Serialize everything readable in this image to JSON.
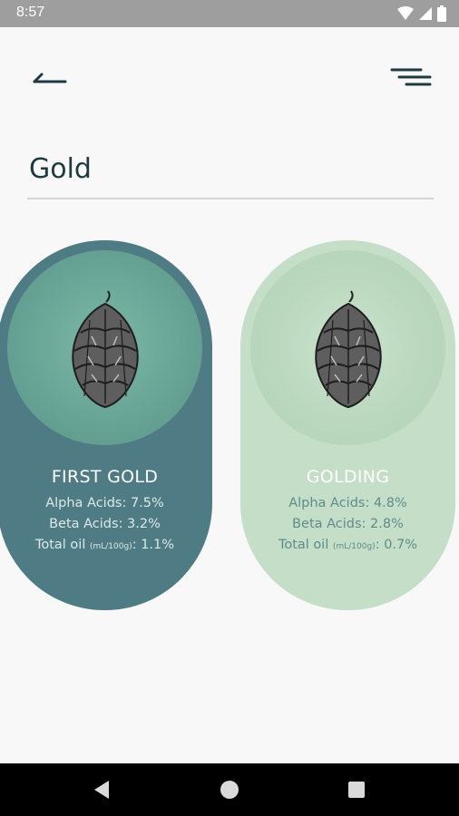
{
  "status_bar": {
    "time": "8:57",
    "icons": [
      "wifi-icon",
      "signal-icon",
      "battery-icon"
    ]
  },
  "header": {
    "back_icon": "back-arrow-icon",
    "menu_icon": "menu-icon"
  },
  "search": {
    "value": "Gold"
  },
  "cards": [
    {
      "name": "FIRST GOLD",
      "alpha": "Alpha Acids: 7.5%",
      "beta": "Beta Acids: 3.2%",
      "oil_label": "Total oil",
      "oil_unit": "(mL/100g)",
      "oil_value": ": 1.1%",
      "colors": {
        "card": "#4f7c84",
        "circle": "#6ba899",
        "text": "#ffffff"
      }
    },
    {
      "name": "GOLDING",
      "alpha": "Alpha Acids: 4.8%",
      "beta": "Beta Acids: 2.8%",
      "oil_label": "Total oil",
      "oil_unit": "(mL/100g)",
      "oil_value": ": 0.7%",
      "colors": {
        "card": "#c4dec7",
        "circle": "#b9d7bd",
        "text": "#5f8c8b"
      }
    }
  ],
  "nav_bar": {
    "buttons": [
      "back-triangle-icon",
      "home-circle-icon",
      "recents-square-icon"
    ]
  }
}
